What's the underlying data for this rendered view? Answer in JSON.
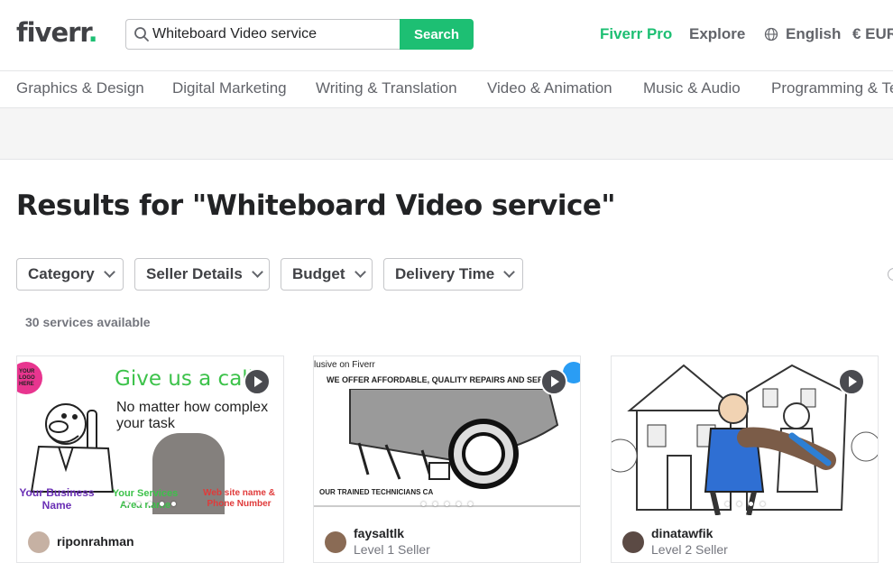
{
  "header": {
    "logo_text": "fiverr",
    "logo_dot": ".",
    "search_value": "Whiteboard Video service",
    "search_button": "Search",
    "nav_pro": "Fiverr Pro",
    "nav_explore": "Explore",
    "nav_language": "English",
    "nav_currency": "€ EUR"
  },
  "categories": [
    "Graphics & Design",
    "Digital Marketing",
    "Writing & Translation",
    "Video & Animation",
    "Music & Audio",
    "Programming & Tech"
  ],
  "results_title": "Results for \"Whiteboard Video service\"",
  "filters": [
    "Category",
    "Seller Details",
    "Budget",
    "Delivery Time"
  ],
  "services_count": "30 services available",
  "cards": [
    {
      "seller": "riponrahman",
      "level": "",
      "thumb": {
        "badge": "YOUR LOGO HERE",
        "headline": "Give us a call",
        "line1": "No matter how complex",
        "line2": "your task",
        "label_business": "Your Business Name",
        "label_services": "Your Services Area name",
        "label_web": "Web site name & Phone Number"
      }
    },
    {
      "seller": "faysaltlk",
      "level": "Level 1 Seller",
      "thumb": {
        "top_text": "lusive on Fiverr",
        "headline": "WE OFFER AFFORDABLE, QUALITY REPAIRS AND SERVICE",
        "bottom_text": "OUR TRAINED TECHNICIANS CA"
      }
    },
    {
      "seller": "dinatawfik",
      "level": "Level 2 Seller",
      "thumb": {}
    }
  ],
  "colors": {
    "brand_green": "#1dbf73",
    "text_dark": "#222325",
    "text_muted": "#62646a"
  }
}
